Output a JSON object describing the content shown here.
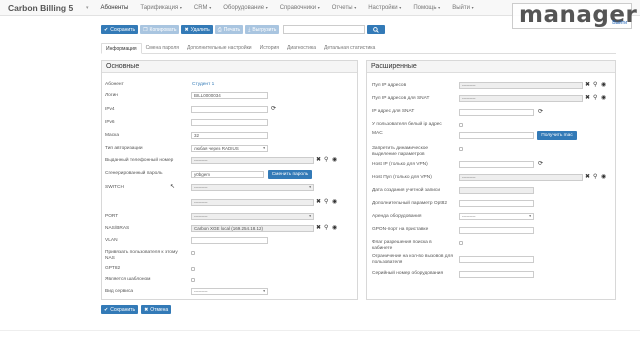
{
  "navbar": {
    "brand": "Carbon Billing 5",
    "items": [
      "Абоненты",
      "Тарификация",
      "CRM",
      "Оборудование",
      "Справочники",
      "Отчеты",
      "Настройки",
      "Помощь",
      "Выйти"
    ]
  },
  "watermark": {
    "text": "manager",
    "sub": "Выйти"
  },
  "toolbar": {
    "save": "Сохранить",
    "copy": "Копировать",
    "delete": "Удалить",
    "print": "Печать",
    "export": "Выгрузить"
  },
  "tabs": [
    "Информация",
    "Смена пароля",
    "Дополнительные настройки",
    "История",
    "Диагностика",
    "Детальная статистика"
  ],
  "left_panel": {
    "title": "Основные",
    "abonent_label": "Абонент",
    "abonent_value": "Студент 1",
    "login_label": "Логин",
    "login_value": "BILL0000034",
    "ipv4_label": "IPv4",
    "ipv6_label": "IPv6",
    "mask_label": "Маска",
    "mask_value": "32",
    "auth_label": "Тип авторизации",
    "auth_value": "любая через RADIUS",
    "phone_label": "Выданный телефонный номер",
    "phone_value": "---------",
    "password_label": "Сгенерированный пароль",
    "password_value": "y0bgem",
    "change_password": "Сменить пароль",
    "switch_label": "SWITCH",
    "switch_value": "---------",
    "switch_value2": "---------",
    "port_label": "PORT",
    "port_value": "---------",
    "nas_label": "NAS/BRAS",
    "nas_value": "Carbon XGE local (169.254.18.12)",
    "vlan_label": "VLAN",
    "priv_label": "Привязать пользователя к этому NAS",
    "gpt_label": "GPT82",
    "template_label": "Является шаблоном",
    "service_label": "Вид сервиса",
    "service_value": "---------"
  },
  "right_panel": {
    "title": "Расширенные",
    "pool_label": "Пул IP адресов",
    "pool_value": "---------",
    "pool_snat_label": "Пул IP адресов для SNAT",
    "pool_snat_value": "---------",
    "ip_snat_label": "IP адрес для SNAT",
    "white_label": "У пользователя белый ip адрес",
    "mac_label": "MAC",
    "get_mac": "Получить mac",
    "dyn_label": "Запретить динамическое выделение параметров",
    "host_ip_label": "Host IP (только для VPN)",
    "host_pool_label": "Host Пул (только для VPN)",
    "host_pool_value": "---------",
    "created_label": "Дата создания учетной записи",
    "opt82_label": "Дополнительный параметр Opt82",
    "rent_label": "Аренда оборудования",
    "rent_value": "---------",
    "gpon_label": "GPON-порт на приставке",
    "search_flag_label": "Флаг разрешения поиска в кабинете",
    "limit_label": "Ограничение на кол-во вызовов для пользователя",
    "serial_label": "Серийный номер оборудования"
  },
  "bottom": {
    "save": "Сохранить",
    "cancel": "Отмена"
  },
  "colors": {
    "primary": "#337ab7",
    "danger": "#d9534f"
  }
}
